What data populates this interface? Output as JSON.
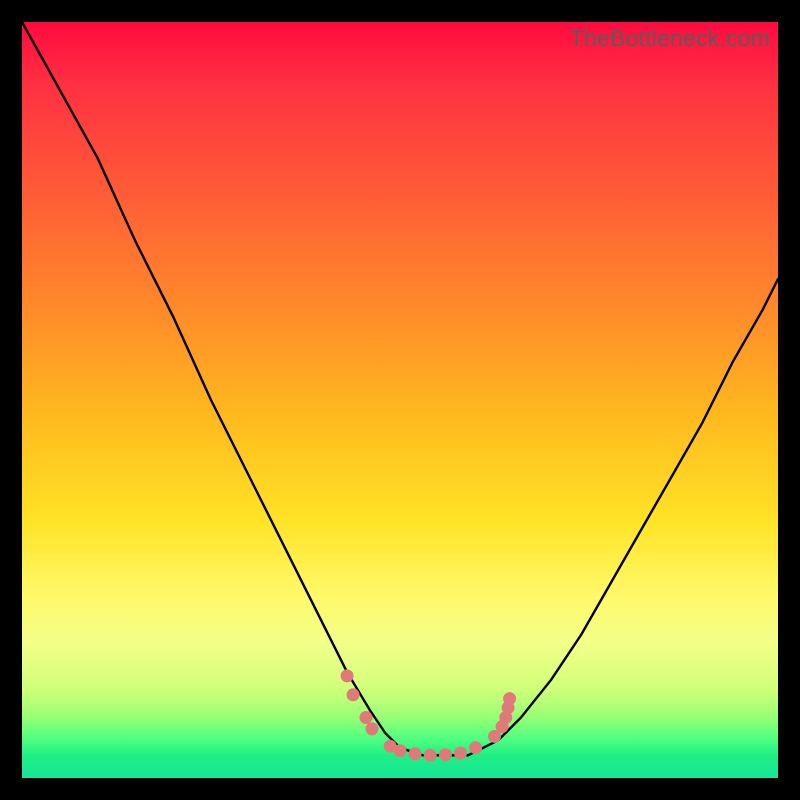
{
  "watermark": "TheBottleneck.com",
  "colors": {
    "frame": "#000000",
    "curve_stroke": "#000000",
    "marker_fill": "#e07a7a",
    "marker_stroke": "#c85f5f",
    "gradient_top": "#ff0b3f",
    "gradient_bottom": "#17e69a"
  },
  "chart_data": {
    "type": "line",
    "title": "",
    "xlabel": "",
    "ylabel": "",
    "xlim": [
      0,
      100
    ],
    "ylim": [
      0,
      100
    ],
    "grid": false,
    "note": "Axes are unlabeled; values are estimated proportions of the plot area. y=0 is the bottom (green), y=100 is the top (red). The curve depicts a V/gorge shape that falls from top-left to a flat minimum around x≈48–60 near y≈3, then rises toward the upper-right.",
    "series": [
      {
        "name": "bottleneck-curve",
        "x": [
          0,
          5,
          10,
          15,
          20,
          25,
          30,
          35,
          40,
          43,
          46,
          48,
          50,
          53,
          56,
          59,
          61,
          63,
          66,
          70,
          74,
          78,
          82,
          86,
          90,
          94,
          98,
          100
        ],
        "y": [
          100,
          91,
          82,
          71,
          61,
          50,
          40,
          30,
          20,
          14,
          9,
          6,
          4,
          3,
          3,
          3,
          4,
          5,
          8,
          13,
          19,
          26,
          33,
          40,
          47,
          55,
          62,
          66
        ]
      }
    ],
    "markers": {
      "name": "trough-markers",
      "note": "Small salmon-colored dots clustered near the curve trough on both sides.",
      "points": [
        {
          "x": 43.0,
          "y": 13.5
        },
        {
          "x": 43.8,
          "y": 11.0
        },
        {
          "x": 45.5,
          "y": 8.0
        },
        {
          "x": 46.3,
          "y": 6.5
        },
        {
          "x": 48.7,
          "y": 4.2
        },
        {
          "x": 50.0,
          "y": 3.6
        },
        {
          "x": 52.0,
          "y": 3.2
        },
        {
          "x": 54.0,
          "y": 3.0
        },
        {
          "x": 56.0,
          "y": 3.1
        },
        {
          "x": 58.0,
          "y": 3.3
        },
        {
          "x": 60.0,
          "y": 4.0
        },
        {
          "x": 62.5,
          "y": 5.5
        },
        {
          "x": 63.5,
          "y": 6.8
        },
        {
          "x": 64.0,
          "y": 8.0
        },
        {
          "x": 64.3,
          "y": 9.3
        },
        {
          "x": 64.5,
          "y": 10.5
        }
      ]
    }
  }
}
